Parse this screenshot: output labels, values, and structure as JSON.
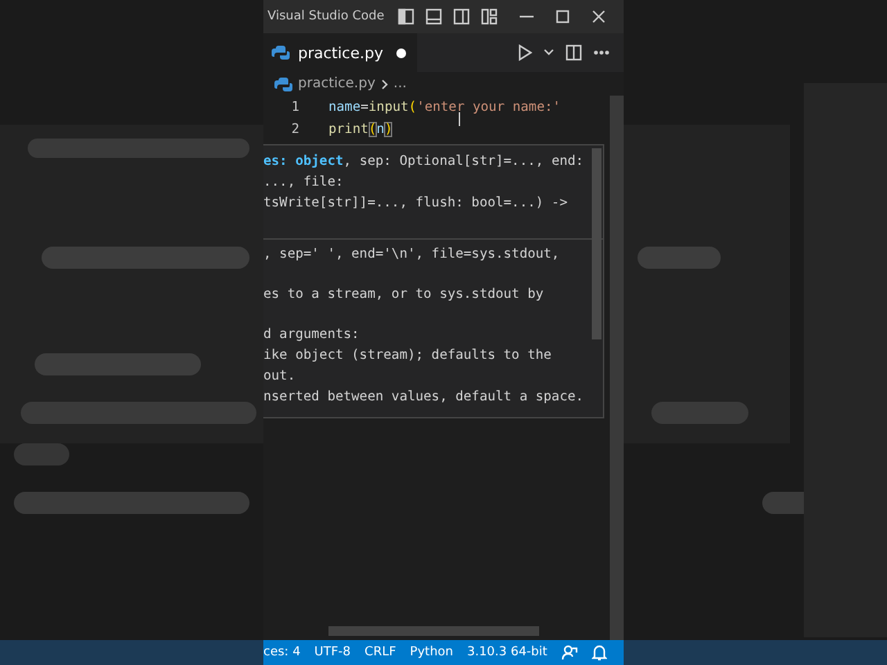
{
  "title_bar": {
    "title": "Visual Studio Code"
  },
  "tabs": [
    {
      "label": "practice.py",
      "selected": true,
      "modified": true
    }
  ],
  "breadcrumb": [
    "practice.py",
    "..."
  ],
  "editor": {
    "lines": [
      {
        "number": "1",
        "tokens": [
          {
            "text": "name",
            "kind": "variable"
          },
          {
            "text": "=",
            "kind": "plain"
          },
          {
            "text": "input",
            "kind": "function"
          },
          {
            "text": "(",
            "kind": "bracket"
          },
          {
            "text": "'enter your name:'",
            "kind": "string"
          }
        ]
      },
      {
        "number": "2",
        "tokens": [
          {
            "text": "print",
            "kind": "function"
          },
          {
            "text": "(",
            "kind": "match"
          },
          {
            "text": "n",
            "kind": "variable"
          },
          {
            "text": ")",
            "kind": "match"
          }
        ]
      }
    ]
  },
  "hover": {
    "signature": [
      [
        {
          "text": "es: ",
          "kind": "param"
        },
        {
          "text": "object",
          "kind": "param"
        },
        {
          "text": ", sep: Optional[str]=..., end:",
          "kind": "plain"
        }
      ],
      [
        {
          "text": "..., file:",
          "kind": "plain"
        }
      ],
      [
        {
          "text": "tsWrite[str]]=..., flush: bool=...) ->",
          "kind": "plain"
        }
      ]
    ],
    "paragraphs": [
      [
        ", sep=' ', end='\\n', file=sys.stdout,"
      ],
      [
        "es to a stream, or to sys.stdout by"
      ],
      [
        "d arguments:",
        "ike object (stream); defaults to the",
        "out.",
        "nserted between values, default a space."
      ]
    ]
  },
  "status_bar": [
    "ces: 4",
    "UTF-8",
    "CRLF",
    "Python",
    "3.10.3 64-bit"
  ]
}
